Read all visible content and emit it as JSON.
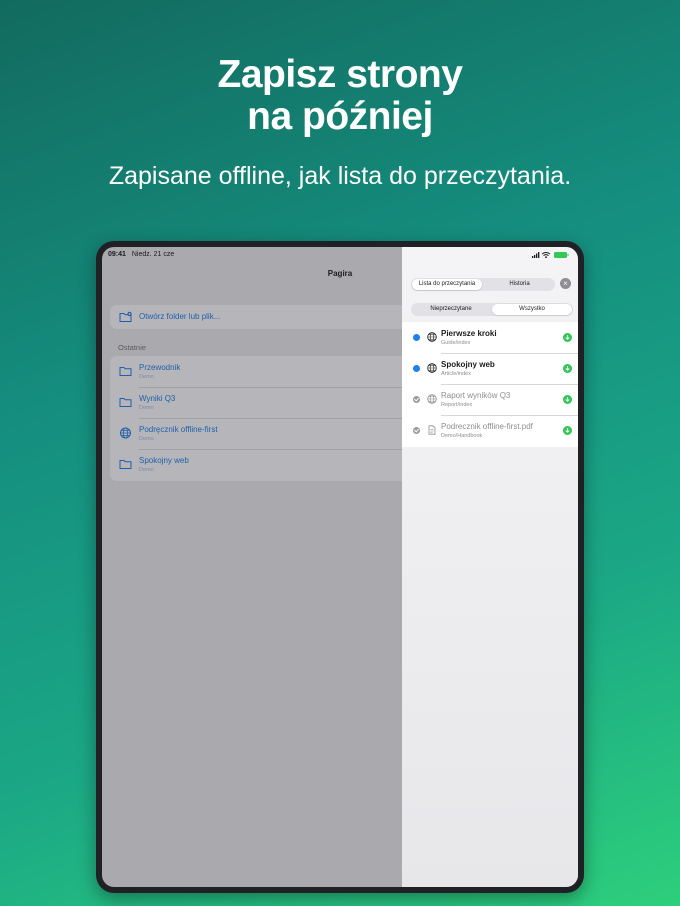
{
  "headline": {
    "line1": "Zapisz strony",
    "line2": "na później"
  },
  "subhead": "Zapisane offline, jak lista do przeczytania.",
  "statusbar": {
    "time": "09:41",
    "date": "Niedz. 21 cze"
  },
  "app": {
    "title": "Pagira"
  },
  "open_action": {
    "label": "Otwórz folder lub plik..."
  },
  "recent": {
    "label": "Ostatnie",
    "items": [
      {
        "title": "Przewodnik",
        "subtitle": "Demo",
        "icon": "folder-icon"
      },
      {
        "title": "Wyniki Q3",
        "subtitle": "Demo",
        "icon": "folder-icon"
      },
      {
        "title": "Podręcznik offline-first",
        "subtitle": "Demo",
        "icon": "globe-icon"
      },
      {
        "title": "Spokojny web",
        "subtitle": "Demo",
        "icon": "folder-icon"
      }
    ]
  },
  "panel": {
    "tabs": [
      {
        "label": "Lista do przeczytania",
        "active": true
      },
      {
        "label": "Historia",
        "active": false
      }
    ],
    "filters": [
      {
        "label": "Nieprzeczytane",
        "active": false
      },
      {
        "label": "Wszystko",
        "active": true
      }
    ],
    "close_glyph": "×",
    "items": [
      {
        "title": "Pierwsze kroki",
        "path": "Guide/index",
        "state": "unread",
        "icon": "globe-icon"
      },
      {
        "title": "Spokojny web",
        "path": "Article/index",
        "state": "unread",
        "icon": "globe-icon"
      },
      {
        "title": "Raport wyników Q3",
        "path": "Report/index",
        "state": "read",
        "icon": "globe-icon"
      },
      {
        "title": "Podrecznik offline-first.pdf",
        "path": "Demo/Handbook",
        "state": "read",
        "icon": "document-icon"
      }
    ]
  },
  "colors": {
    "accent": "#1d7ff0",
    "link": "#1f5fa8",
    "download": "#34c759",
    "battery": "#34c759"
  }
}
